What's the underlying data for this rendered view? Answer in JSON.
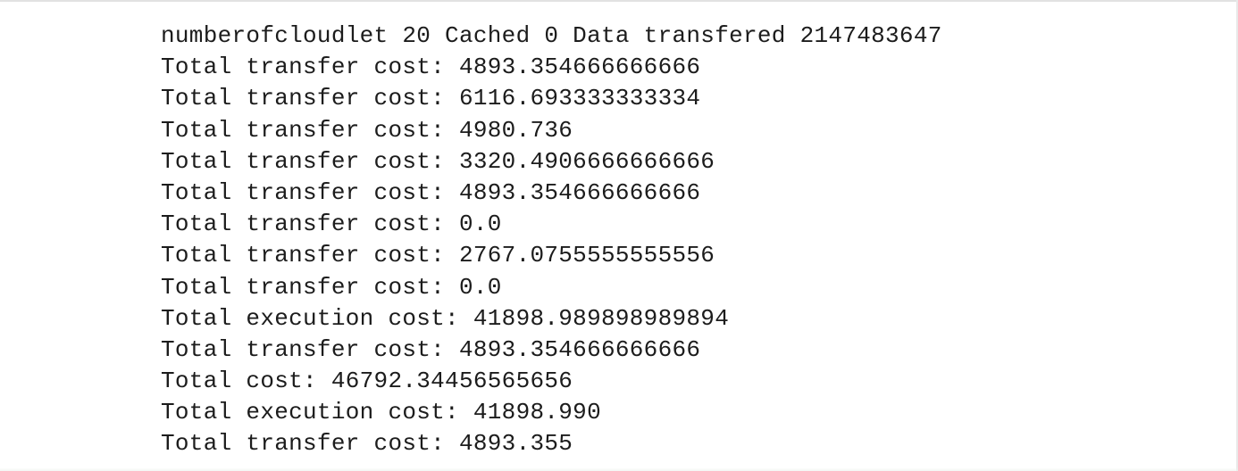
{
  "console": {
    "lines": [
      "numberofcloudlet 20 Cached 0 Data transfered 2147483647",
      "Total transfer cost: 4893.354666666666",
      "Total transfer cost: 6116.693333333334",
      "Total transfer cost: 4980.736",
      "Total transfer cost: 3320.4906666666666",
      "Total transfer cost: 4893.354666666666",
      "Total transfer cost: 0.0",
      "Total transfer cost: 2767.0755555555556",
      "Total transfer cost: 0.0",
      "Total execution cost: 41898.989898989894",
      "Total transfer cost: 4893.354666666666",
      "Total cost: 46792.34456565656",
      "Total execution cost: 41898.990",
      "Total transfer cost: 4893.355"
    ]
  },
  "colors": {
    "background": "#ffffff",
    "text": "#1c1c1c"
  }
}
